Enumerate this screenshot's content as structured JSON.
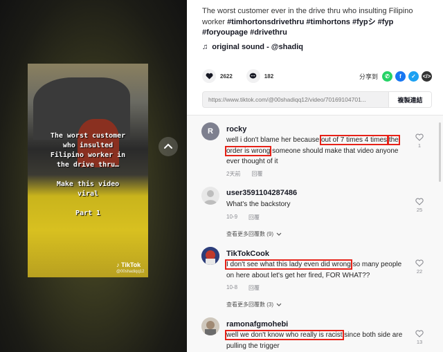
{
  "video": {
    "overlay_line1": "The worst customer",
    "overlay_line2": "who insulted",
    "overlay_line3": "Filipino worker in",
    "overlay_line4": "the drive thru…",
    "overlay_line5": "Make this video",
    "overlay_line6": "viral",
    "overlay_line7": "Part 1",
    "watermark_logo": "TikTok",
    "watermark_user": "@00shadiqq12"
  },
  "post": {
    "desc_text": "The worst customer ever in the drive thru who insulting Filipino worker ",
    "tags": [
      "#timhortonsdrivethru",
      "#timhortons",
      "#fypシ",
      "#fyp",
      "#foryoupage",
      "#drivethru"
    ],
    "sound": "original sound - @shadiq",
    "likes": "2622",
    "comments_count": "182",
    "share_label": "分享到",
    "link_url": "https://www.tiktok.com/@00shadiqq12/video/70169104701...",
    "copy_label": "複製連結"
  },
  "colors": {
    "highlight_box": "#e62117",
    "whatsapp": "#25d366",
    "facebook": "#1877f2",
    "twitter": "#1da1f2",
    "embed": "#333333"
  },
  "comments": [
    {
      "username": "rocky",
      "avatar_letter": "R",
      "text_before": "well i don't blame her because ",
      "text_hl1": "out of 7 times 4 times",
      "text_mid": " ",
      "text_hl2": "the order is wrong",
      "text_after": " someone should make that video anyone ever thought of it",
      "date": "2天前",
      "reply": "回覆",
      "likes": "1"
    },
    {
      "username": "user3591104287486",
      "text": "What's the backstory",
      "date": "10-9",
      "reply": "回覆",
      "likes": "25",
      "more": "查看更多回覆數 (9)"
    },
    {
      "username": "TikTokCook",
      "text_hl": "I don't see what this lady even did wrong",
      "text_after": " so many people on here about let's get her fired, FOR WHAT??",
      "date": "10-8",
      "reply": "回覆",
      "likes": "22",
      "more": "查看更多回覆數 (3)"
    },
    {
      "username": "ramonafgmohebi",
      "text_hl": "well we don't know who really is racist",
      "text_after": " since both side are pulling the trigger",
      "likes": "13"
    }
  ]
}
